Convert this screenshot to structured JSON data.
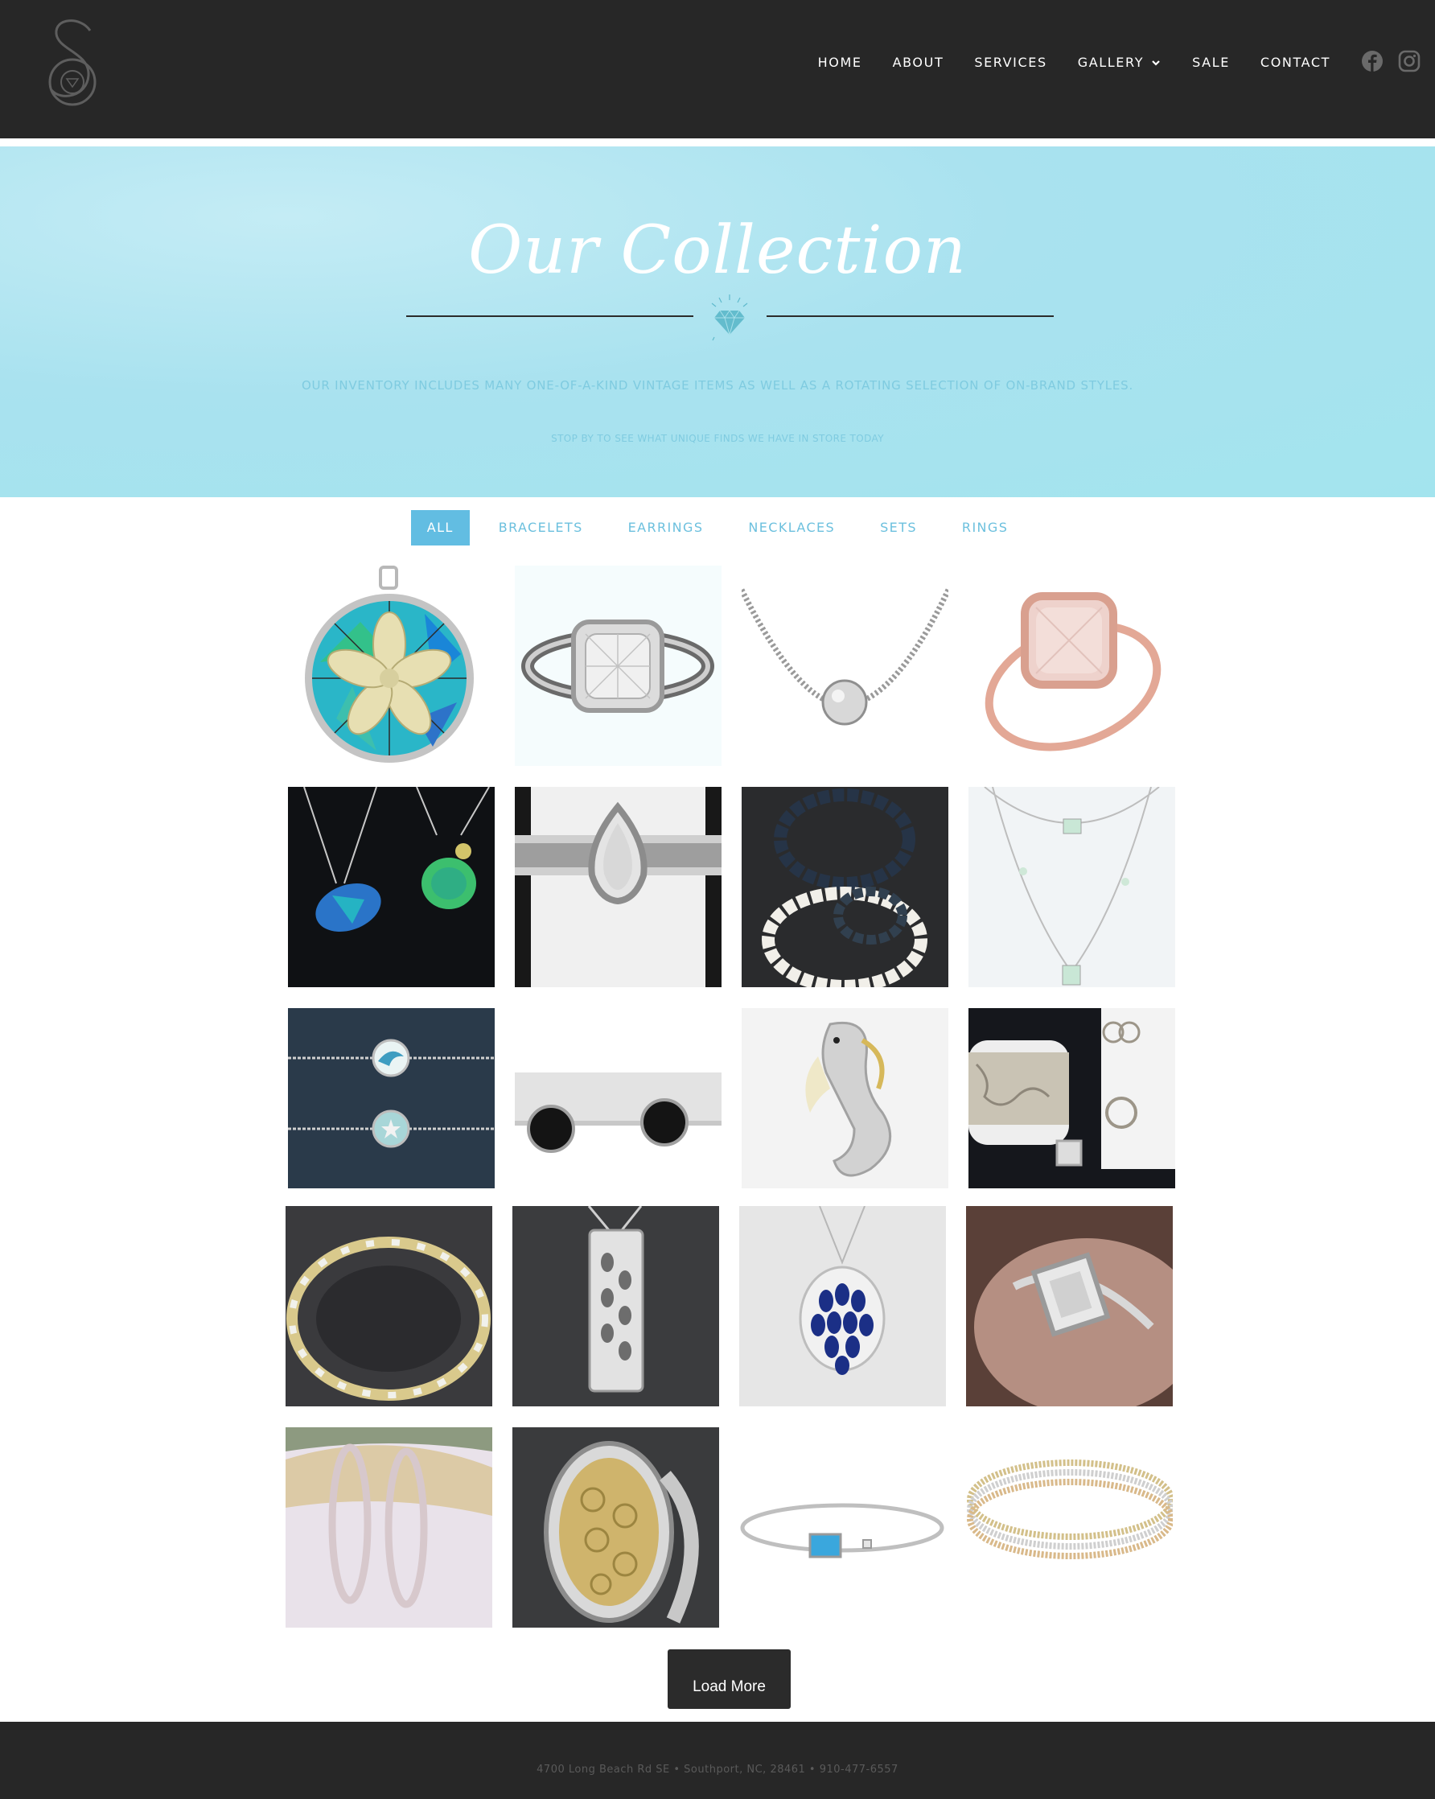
{
  "header": {
    "logo_icon": "brand-s-logo",
    "nav": [
      {
        "label": "HOME"
      },
      {
        "label": "ABOUT"
      },
      {
        "label": "SERVICES"
      },
      {
        "label": "GALLERY",
        "has_dropdown": true
      },
      {
        "label": "SALE"
      },
      {
        "label": "CONTACT"
      }
    ],
    "social": [
      {
        "icon": "facebook-icon"
      },
      {
        "icon": "instagram-icon"
      }
    ]
  },
  "hero": {
    "title": "Our Collection",
    "divider_icon": "diamond-icon",
    "line1": "OUR INVENTORY INCLUDES MANY ONE-OF-A-KIND VINTAGE ITEMS AS WELL AS A ROTATING SELECTION OF ON-BRAND STYLES.",
    "line2": "STOP BY TO SEE WHAT UNIQUE FINDS WE HAVE IN STORE TODAY"
  },
  "filters": [
    {
      "label": "ALL",
      "active": true
    },
    {
      "label": "BRACELETS",
      "active": false
    },
    {
      "label": "EARRINGS",
      "active": false
    },
    {
      "label": "NECKLACES",
      "active": false
    },
    {
      "label": "SETS",
      "active": false
    },
    {
      "label": "RINGS",
      "active": false
    }
  ],
  "gallery": [
    {
      "subject": "opal-sand-dollar-pendant"
    },
    {
      "subject": "cushion-diamond-halo-ring"
    },
    {
      "subject": "pave-ball-necklace"
    },
    {
      "subject": "morganite-rose-gold-ring"
    },
    {
      "subject": "opal-sea-turtle-necklaces"
    },
    {
      "subject": "pear-diamond-halo-ring"
    },
    {
      "subject": "pearl-bracelets"
    },
    {
      "subject": "gemstone-station-necklace"
    },
    {
      "subject": "wave-starfish-bracelets"
    },
    {
      "subject": "black-stud-earrings"
    },
    {
      "subject": "seahorse-pendant"
    },
    {
      "subject": "filigree-cuff-set"
    },
    {
      "subject": "gold-x-link-bracelet"
    },
    {
      "subject": "pave-bar-pendant"
    },
    {
      "subject": "sapphire-cluster-pendant"
    },
    {
      "subject": "emerald-cut-diamond-ring"
    },
    {
      "subject": "diamond-hoop-earrings"
    },
    {
      "subject": "gold-filigree-oval-ring"
    },
    {
      "subject": "blue-topaz-cuff-bracelet"
    },
    {
      "subject": "tri-tone-diamond-bangles"
    }
  ],
  "load_more": "Load More",
  "footer": {
    "address": "4700 Long Beach Rd SE   •   Southport, NC, 28461   •   910-477-6557"
  },
  "colors": {
    "header_bg": "#272727",
    "hero_bg": "#a9e2ef",
    "accent": "#62bde2",
    "filter_text": "#6cc0de",
    "button_bg": "#2b2b2b"
  }
}
